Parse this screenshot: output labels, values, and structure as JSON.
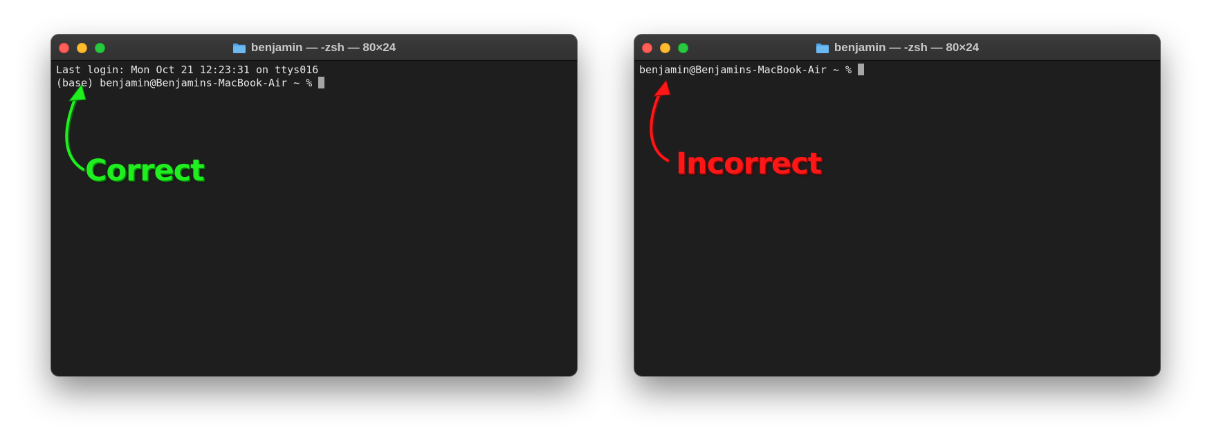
{
  "left_terminal": {
    "title": "benjamin — -zsh — 80×24",
    "lines": [
      "Last login: Mon Oct 21 12:23:31 on ttys016",
      "(base) benjamin@Benjamins-MacBook-Air ~ % "
    ],
    "annotation": "Correct",
    "annotation_color": "#1fef1f"
  },
  "right_terminal": {
    "title": "benjamin — -zsh — 80×24",
    "lines": [
      "benjamin@Benjamins-MacBook-Air ~ % "
    ],
    "annotation": "Incorrect",
    "annotation_color": "#ff1616"
  },
  "theme": {
    "terminal_background": "#1e1e1e",
    "titlebar_background": "#363536",
    "close_color": "#fe5f57",
    "minimize_color": "#febc2e",
    "zoom_color": "#28c840"
  },
  "icons": {
    "title_icon": "folder-icon"
  }
}
